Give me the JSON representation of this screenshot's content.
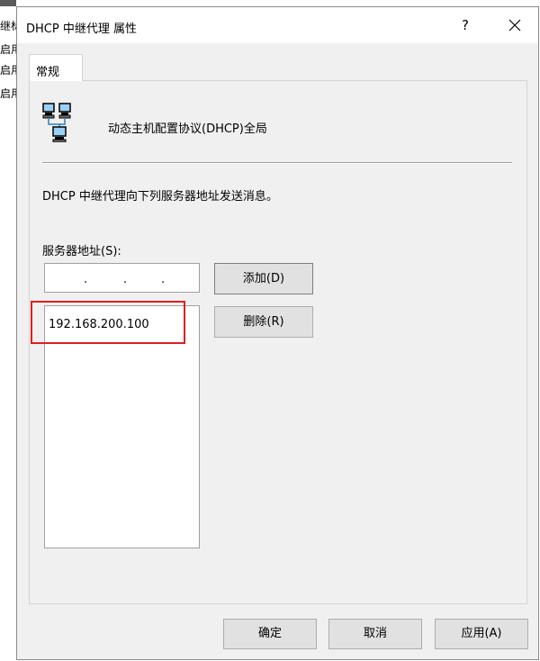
{
  "background_window": {
    "lines": [
      "继标",
      "启用",
      "启用",
      "启用"
    ]
  },
  "dialog": {
    "title": "DHCP 中继代理 属性",
    "help_label": "?",
    "close_icon": "close-icon",
    "tabs": [
      {
        "label": "常规",
        "selected": true
      }
    ],
    "scope_icon": "network-computers-icon",
    "scope_title": "动态主机配置协议(DHCP)全局",
    "description": "DHCP 中继代理向下列服务器地址发送消息。",
    "server_address_label": "服务器地址(S):",
    "ip_input": {
      "separators": [
        ".",
        ".",
        "."
      ]
    },
    "add_button": "添加(D)",
    "remove_button": "删除(R)",
    "server_list": [
      "192.168.200.100"
    ],
    "highlight_color": "#e0201f",
    "footer": {
      "ok": "确定",
      "cancel": "取消",
      "apply": "应用(A)"
    }
  }
}
